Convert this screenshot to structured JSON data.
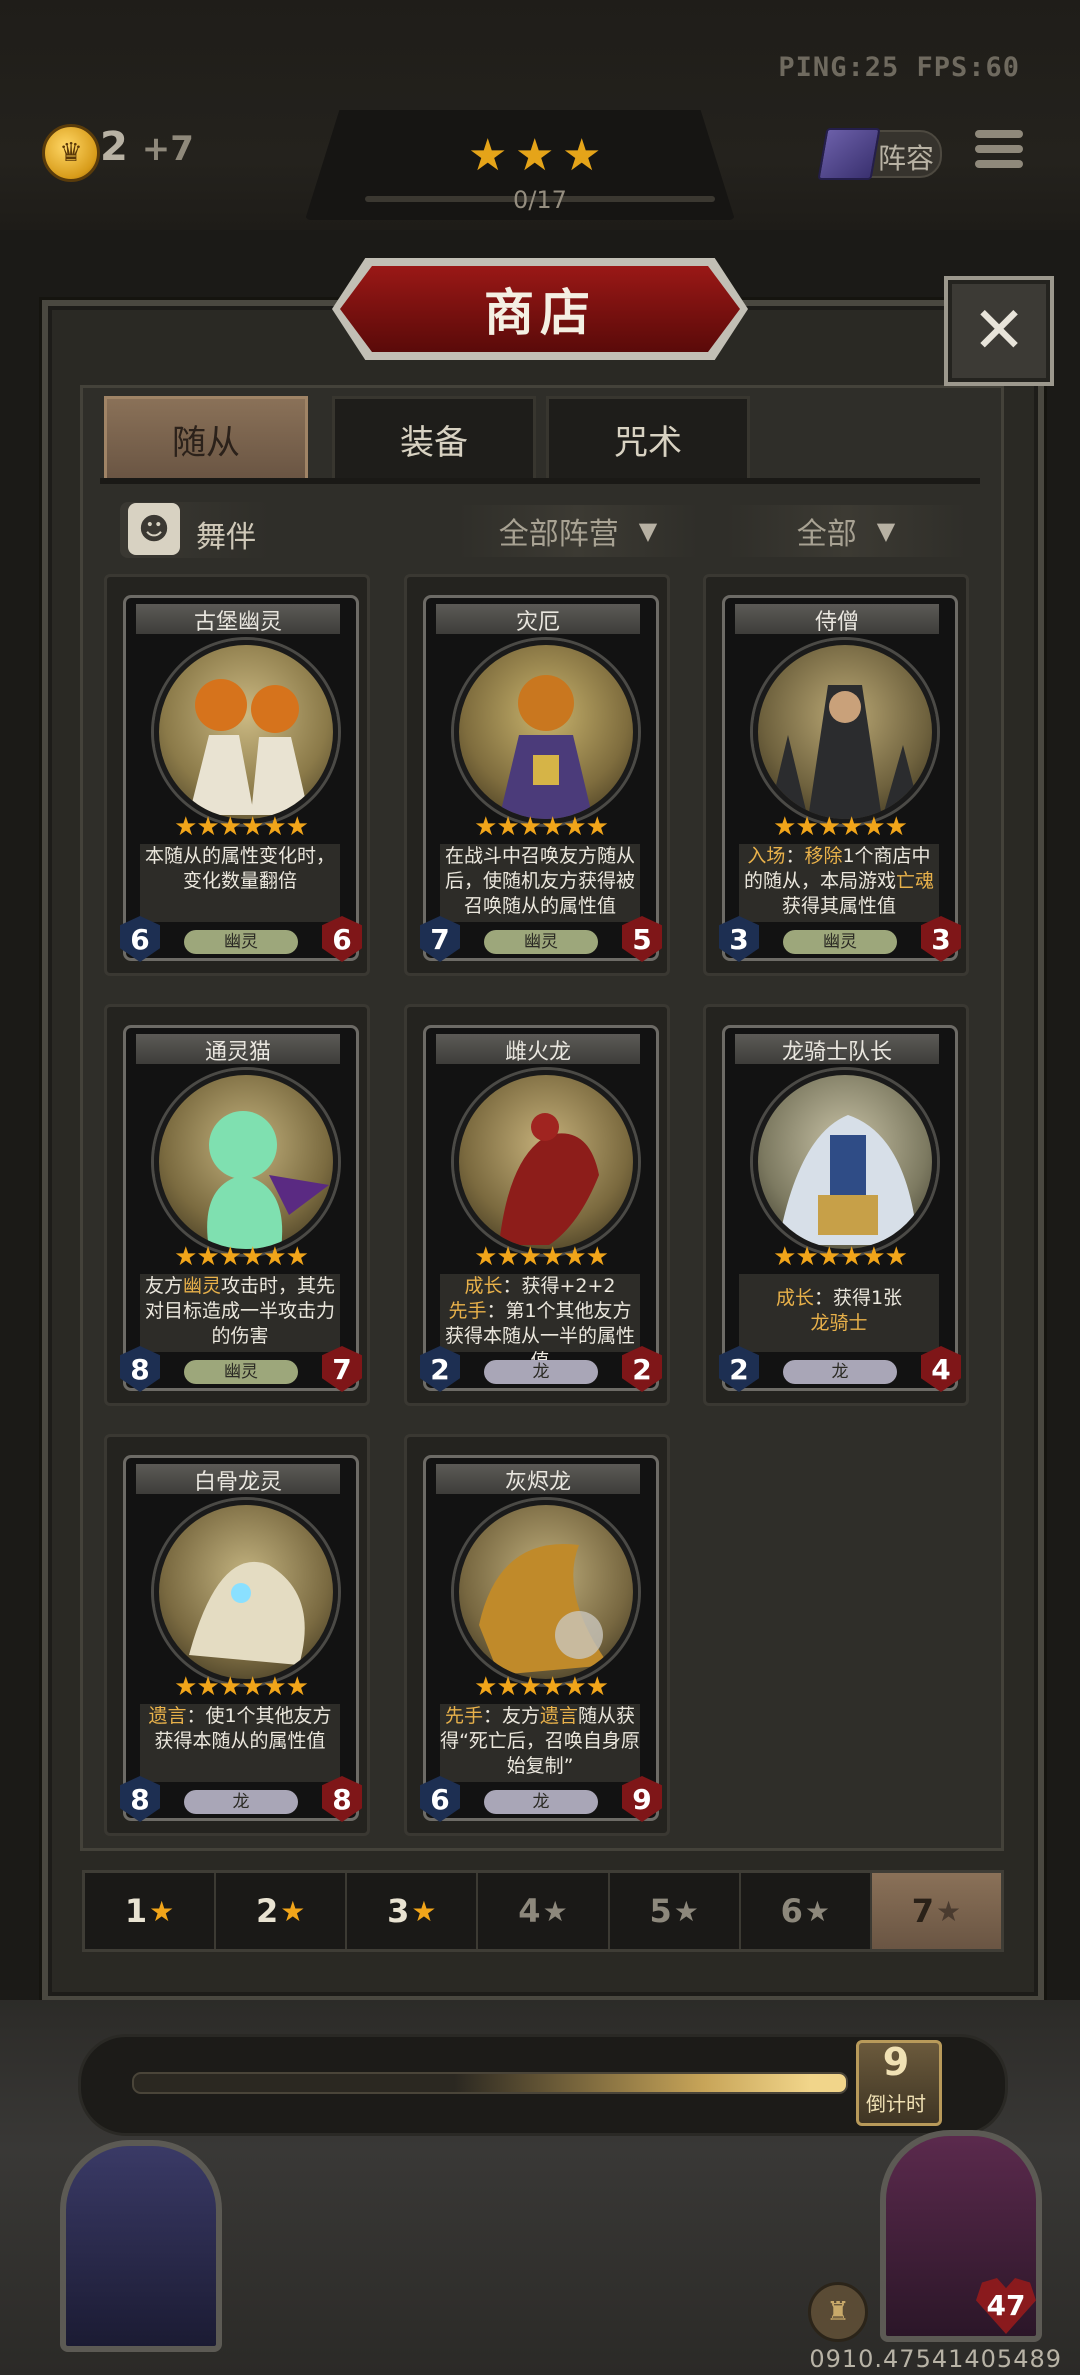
{
  "hud": {
    "ping_fps": "PING:25   FPS:60",
    "gold": "2",
    "gold_bonus": "+7",
    "rank_progress": "0/17",
    "lineup_label": "阵容"
  },
  "shop": {
    "title": "商店",
    "close_symbol": "✕",
    "tabs": [
      "随从",
      "装备",
      "咒术"
    ],
    "active_tab": 0,
    "dancer_label": "舞伴",
    "faction_filter": "全部阵营",
    "all_filter": "全部"
  },
  "cards": [
    {
      "name": "古堡幽灵",
      "stars": "★★★★★★",
      "desc": "本随从的属性变化时，变化数量翻倍",
      "tribe": "幽灵",
      "atk": "6",
      "hp": "6"
    },
    {
      "name": "灾厄",
      "stars": "★★★★★★",
      "desc": "在战斗中召唤友方随从后，使随机友方获得被召唤随从的属性值",
      "tribe": "幽灵",
      "atk": "7",
      "hp": "5"
    },
    {
      "name": "侍僧",
      "stars": "★★★★★★",
      "desc_parts": [
        "入场",
        "：",
        "移除",
        "1个商店中的随从，本局游戏",
        "亡魂",
        "获得其属性值"
      ],
      "tribe": "幽灵",
      "atk": "3",
      "hp": "3"
    },
    {
      "name": "通灵猫",
      "stars": "★★★★★★",
      "desc_parts": [
        "友方",
        "幽灵",
        "攻击时，其先对目标造成一半攻击力的伤害"
      ],
      "tribe": "幽灵",
      "atk": "8",
      "hp": "7"
    },
    {
      "name": "雌火龙",
      "stars": "★★★★★★",
      "desc_parts": [
        "成长",
        "：获得+2+2",
        "先手",
        "：第1个其他友方获得本随从一半的属性值"
      ],
      "tribe": "龙",
      "atk": "2",
      "hp": "2"
    },
    {
      "name": "龙骑士队长",
      "stars": "★★★★★★",
      "desc_parts": [
        "成长",
        "：获得1张",
        "龙骑士"
      ],
      "tribe": "龙",
      "atk": "2",
      "hp": "4"
    },
    {
      "name": "白骨龙灵",
      "stars": "★★★★★★",
      "desc_parts": [
        "遗言",
        "：使1个其他友方获得本随从的属性值"
      ],
      "tribe": "龙",
      "atk": "8",
      "hp": "8"
    },
    {
      "name": "灰烬龙",
      "stars": "★★★★★★",
      "desc_parts": [
        "先手",
        "：友方",
        "遗言",
        "随从获得“死亡后，召唤自身原始复制”"
      ],
      "tribe": "龙",
      "atk": "6",
      "hp": "9"
    }
  ],
  "star_filters": [
    "1",
    "2",
    "3",
    "4",
    "5",
    "6",
    "7"
  ],
  "star_symbol": "★",
  "active_star_filter": 7,
  "timer": {
    "value": "9",
    "label": "倒计时"
  },
  "player": {
    "hp": "47"
  },
  "build_id": "0910.47541405489",
  "colors": {
    "accent_gold": "#f1a51a",
    "title_red": "#9a1816",
    "tribe_ghost": "#9da77b",
    "tribe_dragon": "#a9a6b7"
  }
}
